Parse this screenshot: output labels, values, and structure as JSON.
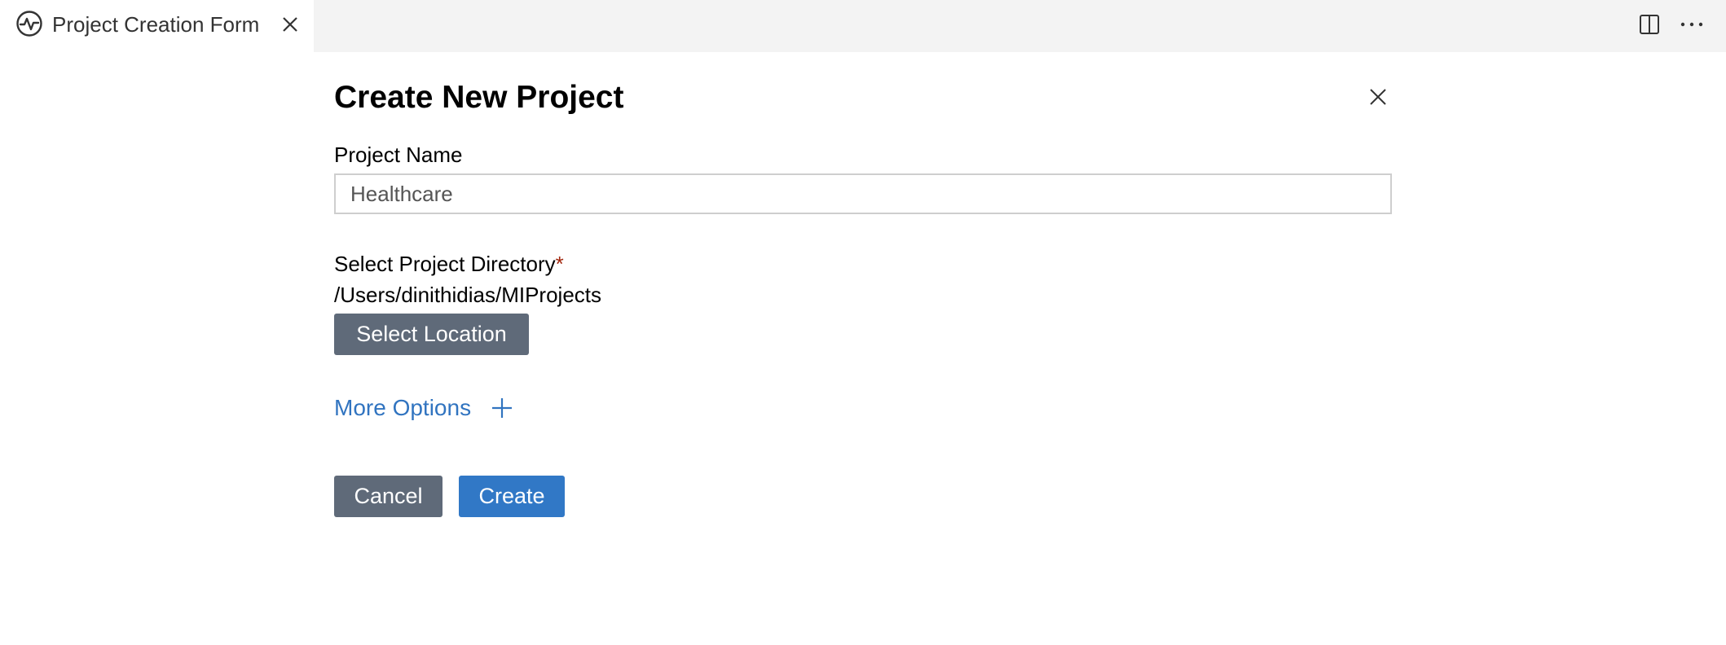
{
  "tab": {
    "title": "Project Creation Form",
    "icon": "activity-icon"
  },
  "editor_actions": {
    "split_icon": "split-editor-icon",
    "more_icon": "more-actions-icon"
  },
  "form": {
    "title": "Create New Project",
    "close_icon": "close-icon",
    "project_name_label": "Project Name",
    "project_name_value": "Healthcare",
    "directory_label": "Select Project Directory",
    "directory_required": "*",
    "directory_path": "/Users/dinithidias/MIProjects",
    "select_location_label": "Select Location",
    "more_options_label": "More Options",
    "cancel_label": "Cancel",
    "create_label": "Create"
  },
  "colors": {
    "primary_button": "#3178c6",
    "secondary_button": "#5f6a79",
    "link": "#3174c0",
    "required": "#a1260d",
    "tabbar_background": "#f3f3f3"
  }
}
